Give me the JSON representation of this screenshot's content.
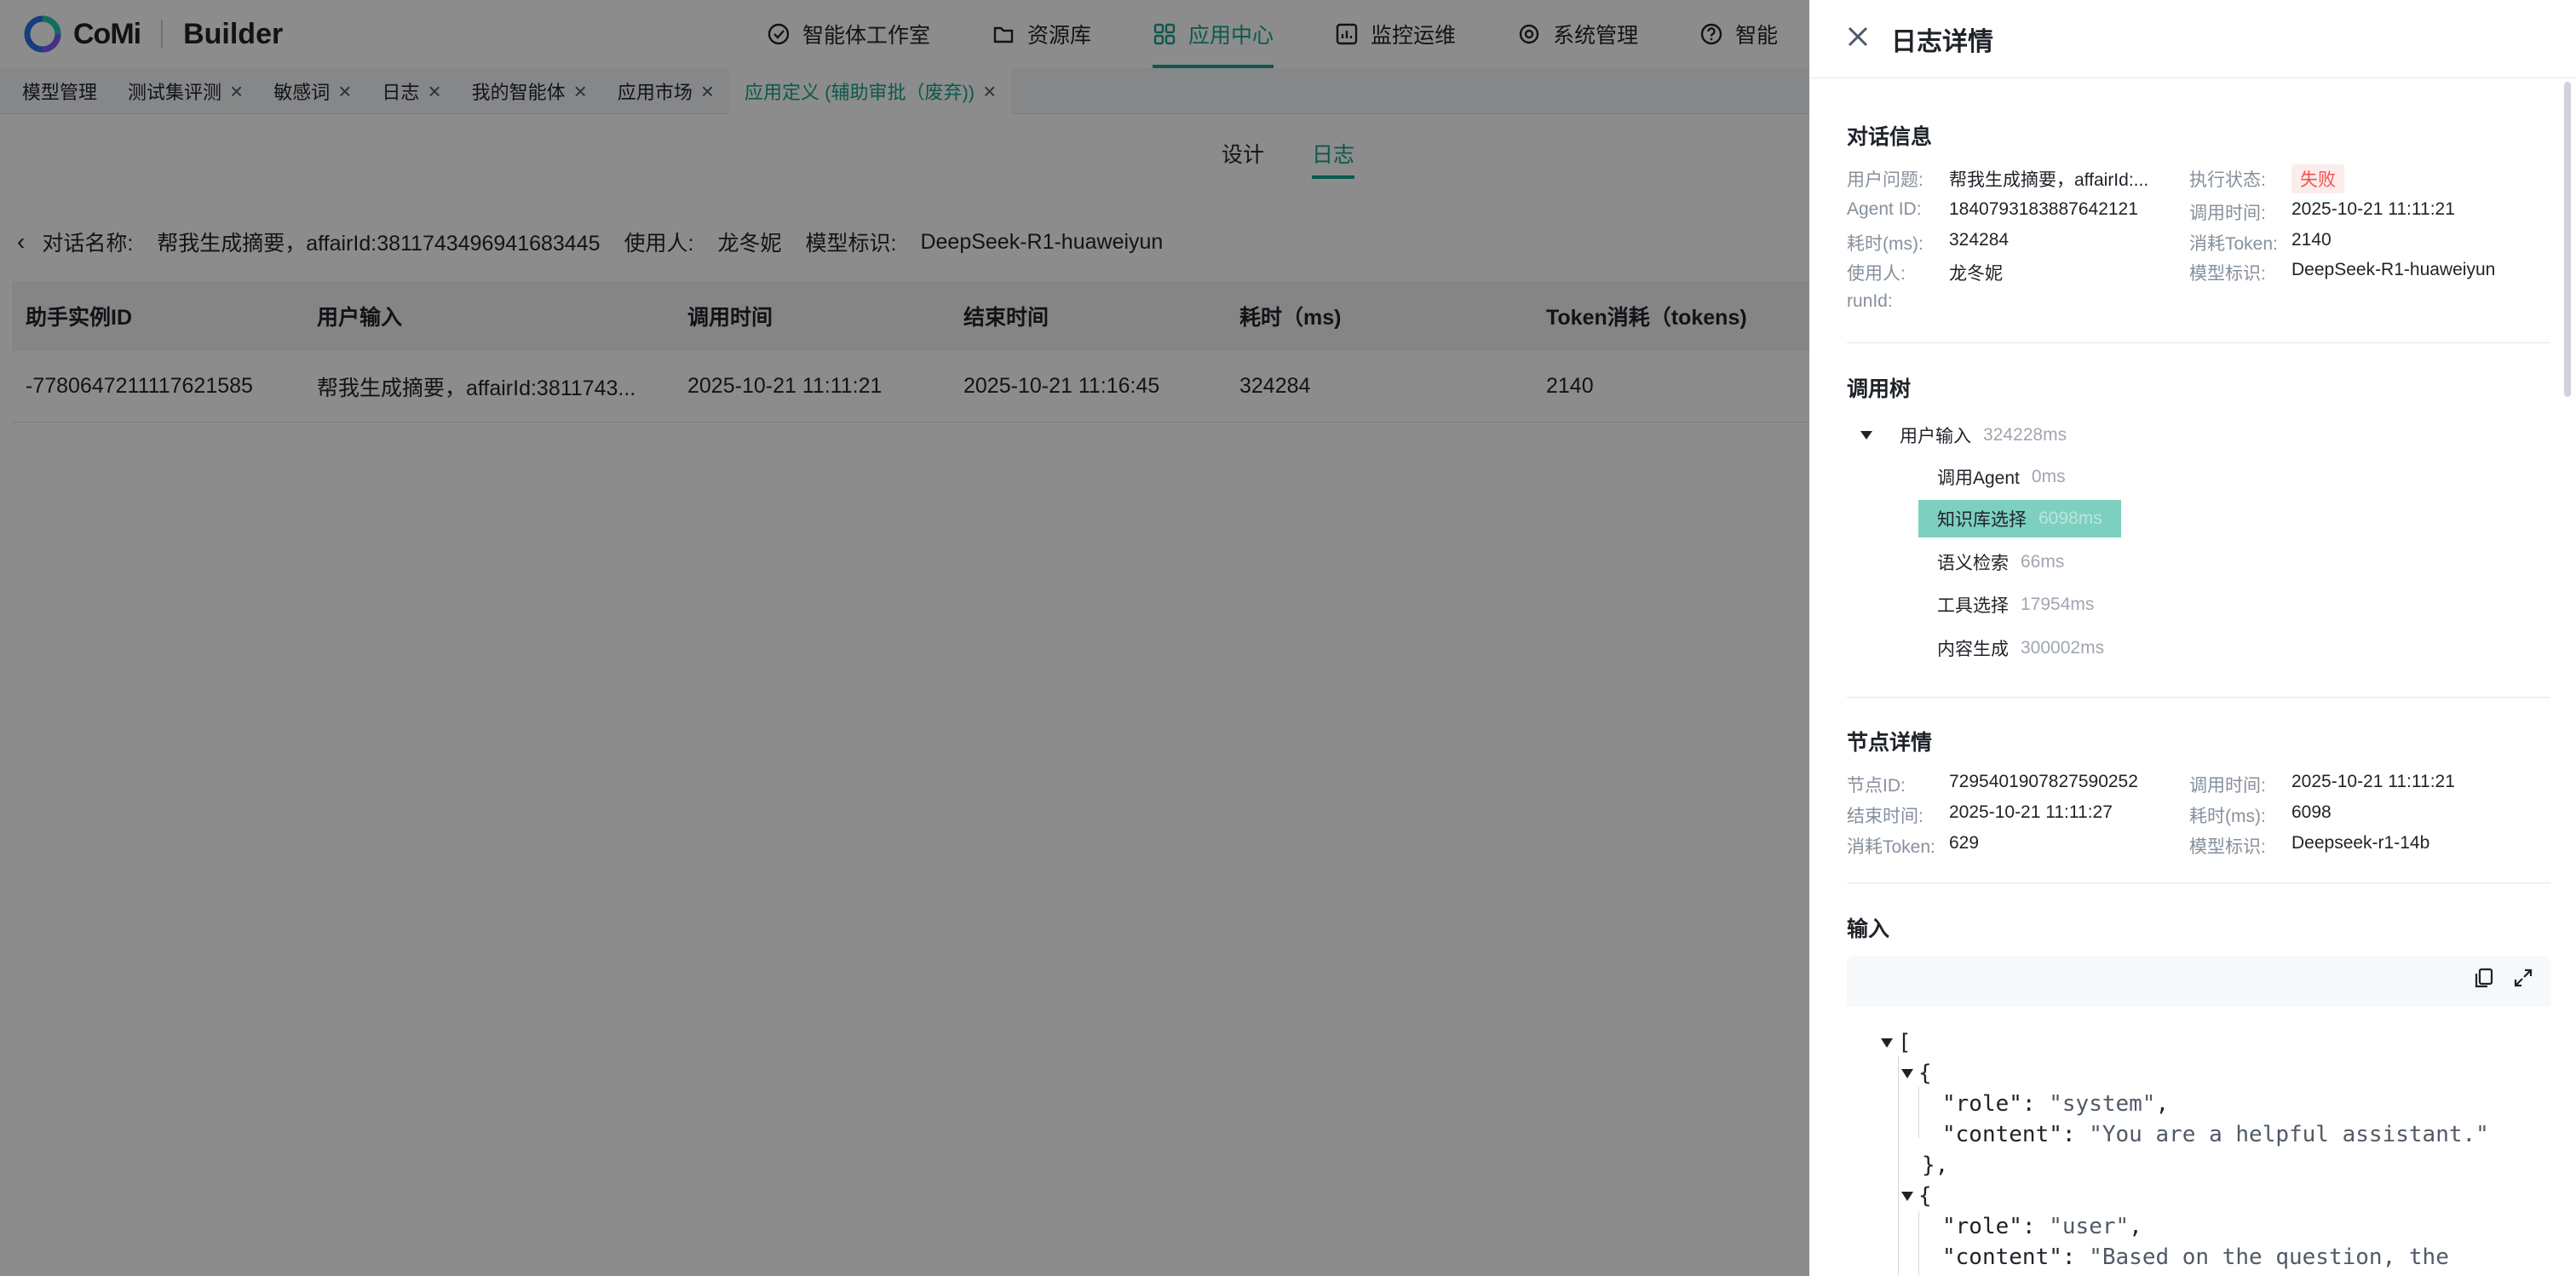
{
  "app": {
    "logo_text": "CoMi",
    "product": "Builder"
  },
  "nav": {
    "items": [
      {
        "label": "智能体工作室",
        "icon": "agent-studio-icon"
      },
      {
        "label": "资源库",
        "icon": "folder-icon"
      },
      {
        "label": "应用中心",
        "icon": "grid-apps-icon",
        "active": true
      },
      {
        "label": "监控运维",
        "icon": "monitor-chart-icon"
      },
      {
        "label": "系统管理",
        "icon": "gear-icon"
      },
      {
        "label": "智能",
        "icon": "help-circle-icon"
      }
    ]
  },
  "tabs": [
    {
      "label": "模型管理",
      "closable": false
    },
    {
      "label": "测试集评测",
      "closable": true
    },
    {
      "label": "敏感词",
      "closable": true
    },
    {
      "label": "日志",
      "closable": true
    },
    {
      "label": "我的智能体",
      "closable": true
    },
    {
      "label": "应用市场",
      "closable": true
    },
    {
      "label": "应用定义 (辅助审批（废弃))",
      "closable": true,
      "active": true
    }
  ],
  "subtabs": [
    {
      "label": "设计"
    },
    {
      "label": "日志",
      "active": true
    }
  ],
  "meta": {
    "conv_label": "对话名称:",
    "conv_value": "帮我生成摘要，affairId:3811743496941683445",
    "user_label": "使用人:",
    "user_value": "龙冬妮",
    "model_label": "模型标识:",
    "model_value": "DeepSeek-R1-huaweiyun"
  },
  "table": {
    "columns": [
      "助手实例ID",
      "用户输入",
      "调用时间",
      "结束时间",
      "耗时（ms)",
      "Token消耗（tokens)"
    ],
    "rows": [
      [
        "-7780647211117621585",
        "帮我生成摘要，affairId:3811743...",
        "2025-10-21 11:11:21",
        "2025-10-21 11:16:45",
        "324284",
        "2140"
      ]
    ]
  },
  "drawer": {
    "title": "日志详情",
    "conversation": {
      "title": "对话信息",
      "question_label": "用户问题:",
      "question_value": "帮我生成摘要，affairId:...",
      "status_label": "执行状态:",
      "status_value": "失败",
      "agent_label": "Agent ID:",
      "agent_value": "1840793183887642121",
      "call_time_label": "调用时间:",
      "call_time_value": "2025-10-21 11:11:21",
      "duration_label": "耗时(ms):",
      "duration_value": "324284",
      "token_label": "消耗Token:",
      "token_value": "2140",
      "user_label": "使用人:",
      "user_value": "龙冬妮",
      "model_label": "模型标识:",
      "model_value": "DeepSeek-R1-huaweiyun",
      "runid_label": "runId:",
      "runid_value": ""
    },
    "tree": {
      "title": "调用树",
      "root": {
        "name": "用户输入",
        "ms": "324228ms"
      },
      "children": [
        {
          "name": "调用Agent",
          "ms": "0ms"
        },
        {
          "name": "知识库选择",
          "ms": "6098ms",
          "selected": true
        },
        {
          "name": "语义检索",
          "ms": "66ms"
        },
        {
          "name": "工具选择",
          "ms": "17954ms"
        },
        {
          "name": "内容生成",
          "ms": "300002ms"
        }
      ]
    },
    "node": {
      "title": "节点详情",
      "id_label": "节点ID:",
      "id_value": "7295401907827590252",
      "call_time_label": "调用时间:",
      "call_time_value": "2025-10-21 11:11:21",
      "end_label": "结束时间:",
      "end_value": "2025-10-21 11:11:27",
      "duration_label": "耗时(ms):",
      "duration_value": "6098",
      "token_label": "消耗Token:",
      "token_value": "629",
      "model_label": "模型标识:",
      "model_value": "Deepseek-r1-14b"
    },
    "input": {
      "title": "输入",
      "lines": {
        "l1": "[",
        "l2": "{",
        "l3_key": "\"role\"",
        "l3_val": "\"system\"",
        "l4_key": "\"content\"",
        "l4_val": "\"You are a helpful assistant.\"",
        "l5": "},",
        "l6": "{",
        "l7_key": "\"role\"",
        "l7_val": "\"user\"",
        "l8_key": "\"content\"",
        "l8_val": "\"Based on the question, the"
      }
    }
  },
  "colors": {
    "accent": "#14a38b",
    "fail": "#f05252",
    "selected_node": "#7dcfbf"
  }
}
